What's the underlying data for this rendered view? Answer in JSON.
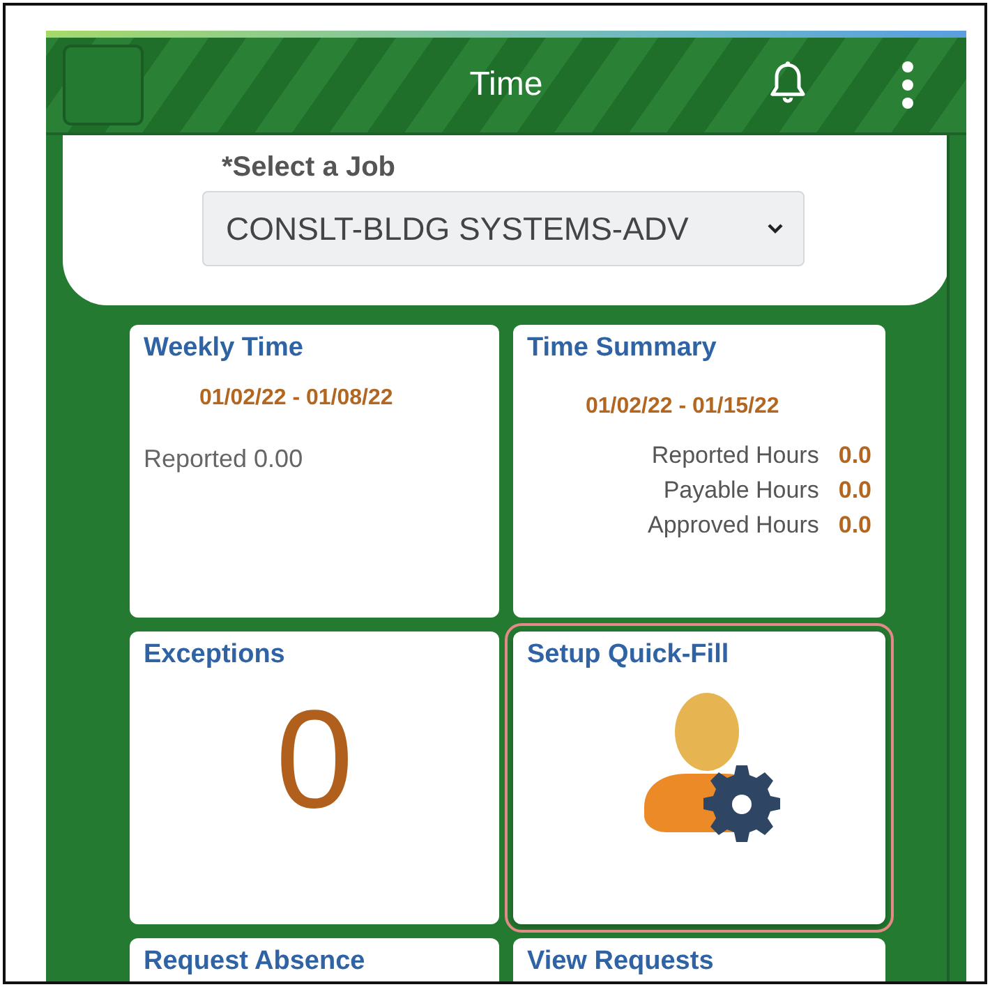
{
  "header": {
    "title": "Time"
  },
  "job_select": {
    "label": "*Select a Job",
    "value": "CONSLT-BLDG SYSTEMS-ADV"
  },
  "tiles": [
    {
      "kind": "weekly",
      "title": "Weekly Time",
      "dates": "01/02/22 - 01/08/22",
      "text": "Reported 0.00",
      "highlighted": false
    },
    {
      "kind": "summary",
      "title": "Time Summary",
      "dates": "01/02/22 - 01/15/22",
      "rows": [
        {
          "label": "Reported Hours",
          "value": "0.0"
        },
        {
          "label": "Payable Hours",
          "value": "0.0"
        },
        {
          "label": "Approved Hours",
          "value": "0.0"
        }
      ],
      "highlighted": false
    },
    {
      "kind": "count",
      "title": "Exceptions",
      "count": "0",
      "highlighted": false
    },
    {
      "kind": "icon",
      "title": "Setup Quick-Fill",
      "highlighted": true
    },
    {
      "kind": "plain",
      "title": "Request Absence",
      "highlighted": false
    },
    {
      "kind": "plain",
      "title": "View Requests",
      "highlighted": false
    }
  ]
}
